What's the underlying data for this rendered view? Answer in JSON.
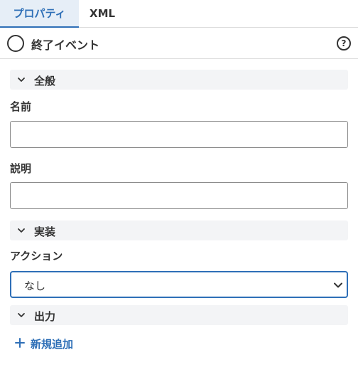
{
  "tabs": [
    {
      "label": "プロパティ",
      "active": true
    },
    {
      "label": "XML",
      "active": false
    }
  ],
  "header": {
    "icon": "end-event-circle-icon",
    "title": "終了イベント",
    "help_icon": "help-icon",
    "help_glyph": "?"
  },
  "sections": {
    "general": {
      "label": "全般",
      "expanded": true
    },
    "implementation": {
      "label": "実装",
      "expanded": true
    },
    "output": {
      "label": "出力",
      "expanded": true
    }
  },
  "fields": {
    "name": {
      "label": "名前",
      "value": ""
    },
    "description": {
      "label": "説明",
      "value": ""
    },
    "action": {
      "label": "アクション",
      "value": "なし"
    }
  },
  "add_new": {
    "label": "新規追加"
  },
  "colors": {
    "accent": "#2e6fb7",
    "tab_active_bg": "#e6eef7",
    "section_bg": "#f3f4f6"
  }
}
